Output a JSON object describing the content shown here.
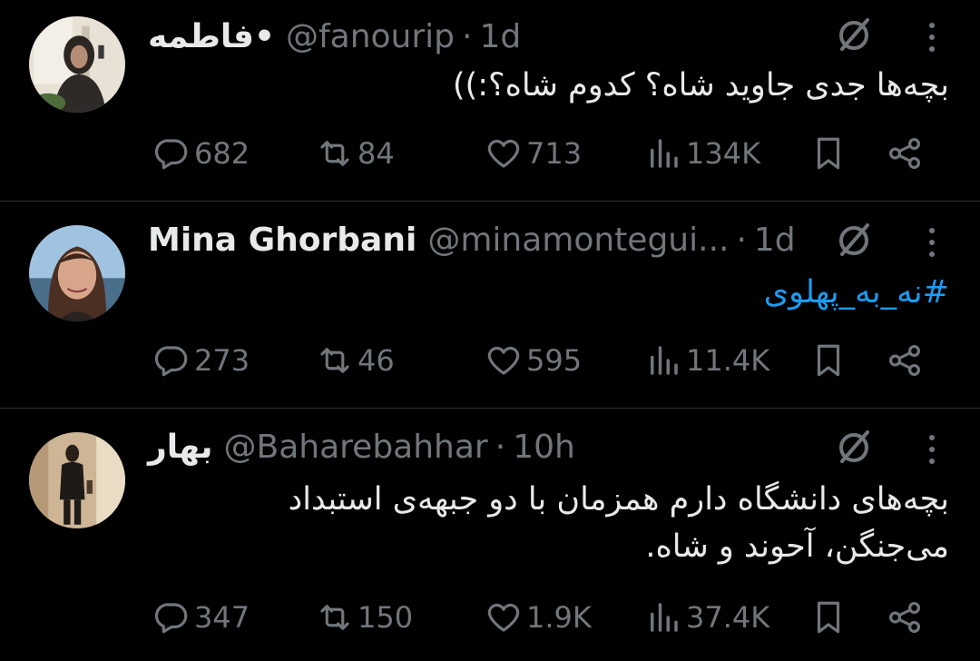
{
  "tweets": [
    {
      "name": "فاطمه",
      "name_suffix": " •",
      "handle": "@fanourip",
      "time": "1d",
      "text": "بچه‌ها جدی جاوید شاه؟ کدوم شاه؟:))",
      "replies": "682",
      "retweets": "84",
      "likes": "713",
      "views": "134K"
    },
    {
      "name": "Mina Ghorbani",
      "handle": "@minamontegui...",
      "time": "1d",
      "text": "#نه_به_پهلوی",
      "replies": "273",
      "retweets": "46",
      "likes": "595",
      "views": "11.4K"
    },
    {
      "name": "بهار",
      "handle": "@Baharebahhar",
      "time": "10h",
      "text": "بچه‌های دانشگاه دارم همزمان با دو جبهه‌ی استبداد می‌جنگن، آحوند و شاه.",
      "replies": "347",
      "retweets": "150",
      "likes": "1.9K",
      "views": "37.4K"
    }
  ],
  "icons": {
    "reply": "reply-icon",
    "retweet": "retweet-icon",
    "like": "heart-icon",
    "views": "views-icon",
    "bookmark": "bookmark-icon",
    "share": "share-icon",
    "grok": "grok-icon",
    "more": "more-icon"
  },
  "colors": {
    "background": "#000000",
    "text": "#e7e9ea",
    "muted": "#71767b",
    "link": "#1d9bf0",
    "divider": "#2f3336"
  }
}
